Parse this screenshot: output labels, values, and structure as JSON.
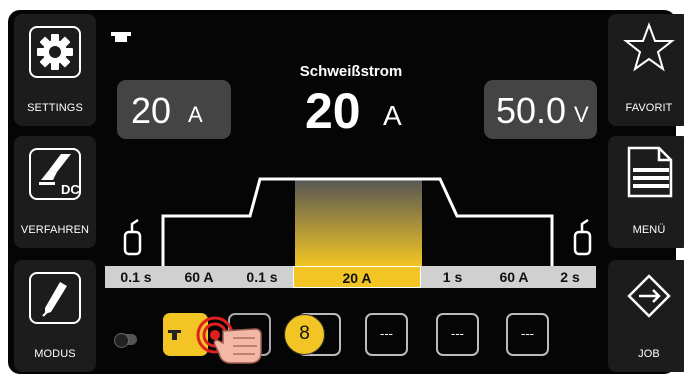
{
  "left_panel": {
    "settings_label": "SETTINGS",
    "process_label": "VERFAHREN",
    "process_badge": "DC",
    "mode_label": "MODUS"
  },
  "right_panel": {
    "favorite_label": "FAVORIT",
    "menu_label": "MENÜ",
    "job_label": "JOB"
  },
  "center": {
    "title": "Schweißstrom",
    "main_value": "20",
    "main_unit": "A",
    "left_box": {
      "value": "20",
      "unit": "A"
    },
    "right_box": {
      "value": "50.0",
      "unit": "V"
    }
  },
  "parameters": [
    {
      "value": "0.1 s",
      "active": false
    },
    {
      "value": "60 A",
      "active": false
    },
    {
      "value": "0.1 s",
      "active": false
    },
    {
      "value": "20 A",
      "active": true
    },
    {
      "value": "1 s",
      "active": false
    },
    {
      "value": "60 A",
      "active": false
    },
    {
      "value": "2 s",
      "active": false
    }
  ],
  "slots": [
    "---",
    "---",
    "---",
    "---"
  ],
  "callout_number": "8",
  "colors": {
    "accent": "#f2c524",
    "background": "#050505",
    "button": "#1c1c1c",
    "value_box": "#444444"
  },
  "icons": [
    "gear-icon",
    "torch-icon",
    "pen-icon",
    "star-icon",
    "document-icon",
    "diamond-arrows-icon",
    "gas-bottle-icon",
    "hand-pointer-icon"
  ]
}
